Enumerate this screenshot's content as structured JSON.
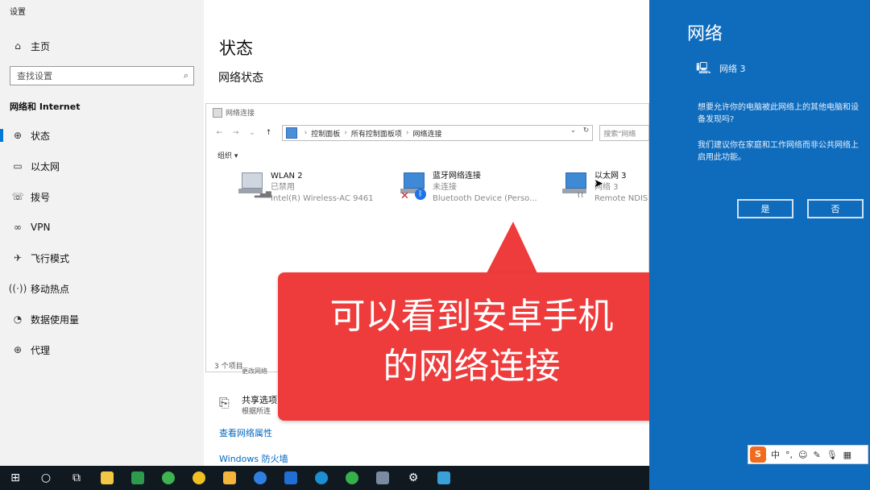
{
  "settings": {
    "app_title": "设置",
    "home": "主页",
    "search_placeholder": "查找设置",
    "section": "网络和 Internet",
    "nav": [
      {
        "label": "状态",
        "icon": "status-icon"
      },
      {
        "label": "以太网",
        "icon": "ethernet-icon"
      },
      {
        "label": "拨号",
        "icon": "dialup-icon"
      },
      {
        "label": "VPN",
        "icon": "vpn-icon"
      },
      {
        "label": "飞行模式",
        "icon": "airplane-icon"
      },
      {
        "label": "移动热点",
        "icon": "hotspot-icon"
      },
      {
        "label": "数据使用量",
        "icon": "data-usage-icon"
      },
      {
        "label": "代理",
        "icon": "globe-icon"
      }
    ],
    "page_title": "状态",
    "subtitle": "网络状态",
    "share_title": "共享选项",
    "share_sub": "根据所连",
    "link_props": "查看网络属性",
    "link_fw": "Windows 防火墙",
    "partial": "更改网络"
  },
  "network_window": {
    "title": "网络连接",
    "breadcrumb": [
      "控制面板",
      "所有控制面板项",
      "网络连接"
    ],
    "search_placeholder": "搜索\"网络",
    "organize": "组织 ▾",
    "adapters": [
      {
        "name": "WLAN 2",
        "status": "已禁用",
        "device": "Intel(R) Wireless-AC 9461"
      },
      {
        "name": "蓝牙网络连接",
        "status": "未连接",
        "device": "Bluetooth Device (Perso..."
      },
      {
        "name": "以太网 3",
        "status": "网络 3",
        "device": "Remote NDIS"
      }
    ],
    "item_count": "3 个项目"
  },
  "callout": {
    "line1": "可以看到安卓手机",
    "line2": "的网络连接"
  },
  "flyout": {
    "title": "网络",
    "network_name": "网络 3",
    "question": "想要允许你的电脑被此网络上的其他电脑和设备发现吗?",
    "recommendation": "我们建议你在家庭和工作网络而非公共网络上启用此功能。",
    "yes": "是",
    "no": "否"
  },
  "ime": {
    "logo": "S",
    "mode": "中"
  },
  "colors": {
    "accent": "#0078d7",
    "flyout": "#0f6cbd",
    "callout": "#ee3b3b",
    "taskbar": "#101820"
  }
}
